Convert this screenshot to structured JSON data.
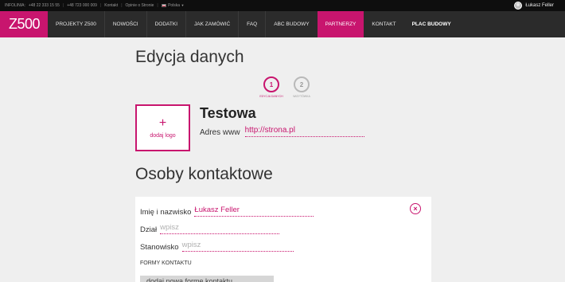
{
  "topbar": {
    "hotline_label": "INFOLINIA:",
    "phone1": "+48 22 333 15 55",
    "phone2": "+48 723 000 009",
    "contact": "Kontakt",
    "opinions": "Opinie o Stronie",
    "language": "Polska",
    "user_name": "Łukasz Feller"
  },
  "nav": {
    "logo": "Z500",
    "items": [
      {
        "label": "Projekty Z500"
      },
      {
        "label": "Nowości"
      },
      {
        "label": "Dodatki"
      },
      {
        "label": "Jak zamówić"
      },
      {
        "label": "FAQ"
      },
      {
        "label": "ABC Budowy"
      },
      {
        "label": "Partnerzy"
      },
      {
        "label": "Kontakt"
      },
      {
        "label": "Plac budowy"
      }
    ]
  },
  "main": {
    "title": "Edycja danych",
    "steps": [
      {
        "number": "1",
        "label": "Edycja danych"
      },
      {
        "number": "2",
        "label": "Wizytówka"
      }
    ],
    "logo_upload": {
      "plus": "+",
      "label": "dodaj logo"
    },
    "company_name": "Testowa",
    "www": {
      "label": "Adres www",
      "value": "http://strona.pl"
    }
  },
  "contacts": {
    "title": "Osoby kontaktowe",
    "fields": [
      {
        "label": "Imię i nazwisko",
        "value": "Łukasz Feller"
      },
      {
        "label": "Dział",
        "placeholder": "wpisz"
      },
      {
        "label": "Stanowisko",
        "placeholder": "wpisz"
      }
    ],
    "forms_label": "Formy kontaktu",
    "add_form_label": "dodaj nową formę kontaktu",
    "close_symbol": "×"
  },
  "colors": {
    "accent": "#c8156e",
    "nav_bg": "#2b2b2b",
    "topbar_bg": "#0e0e0e",
    "page_bg": "#efefef"
  }
}
